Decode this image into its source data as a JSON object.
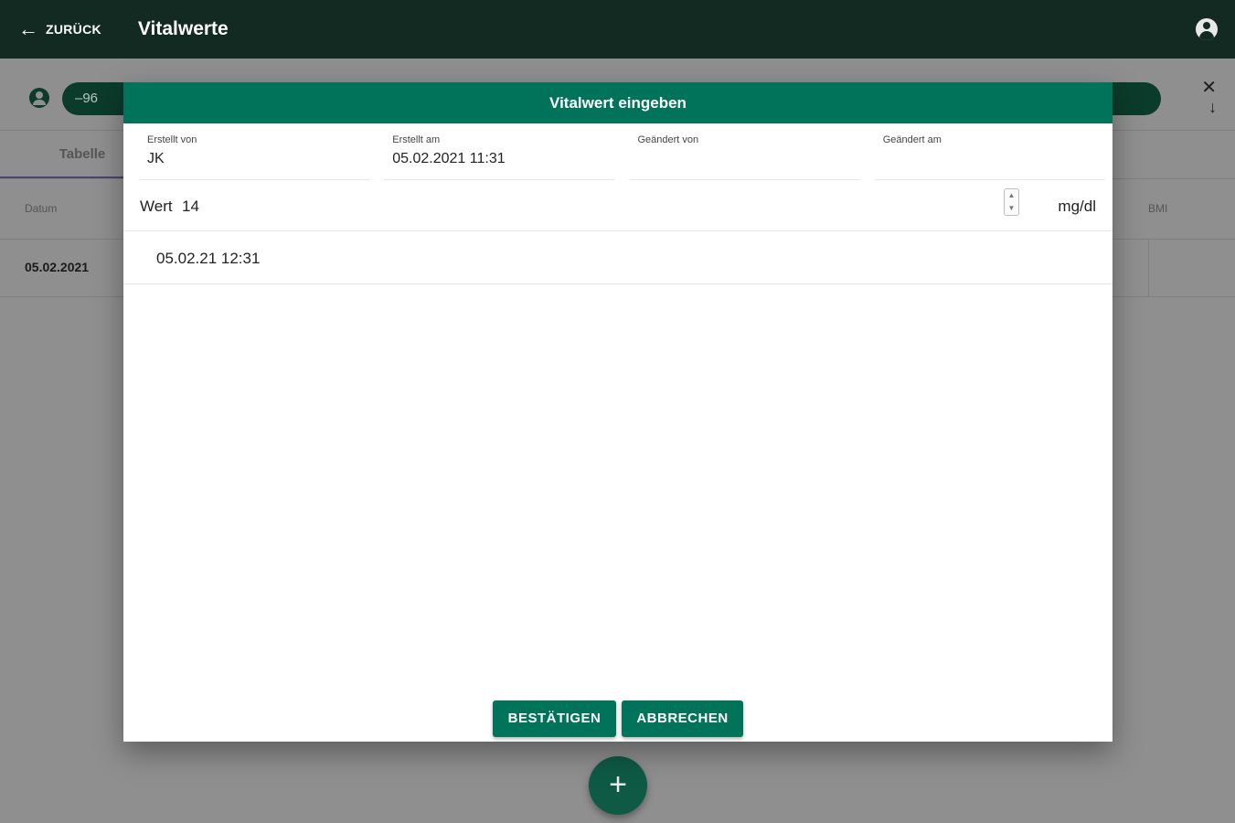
{
  "appbar": {
    "back_label": "ZURÜCK",
    "title": "Vitalwerte"
  },
  "background": {
    "pill_value": "–96",
    "tab_label": "Tabelle",
    "columns": [
      "Datum",
      "BMI"
    ],
    "rows": [
      {
        "datum": "05.02.2021"
      }
    ],
    "fab_label": "+"
  },
  "dialog": {
    "title": "Vitalwert eingeben",
    "meta": [
      {
        "label": "Erstellt von",
        "value": "JK"
      },
      {
        "label": "Erstellt am",
        "value": "05.02.2021 11:31"
      },
      {
        "label": "Geändert von",
        "value": ""
      },
      {
        "label": "Geändert am",
        "value": ""
      }
    ],
    "wert_label": "Wert",
    "wert_value": "14",
    "unit": "mg/dl",
    "datetime": "05.02.21 12:31",
    "confirm_label": "BESTÄTIGEN",
    "cancel_label": "ABBRECHEN"
  },
  "colors": {
    "appbar": "#132a23",
    "primary": "#00735a",
    "overlay": "#8f8f8f"
  }
}
